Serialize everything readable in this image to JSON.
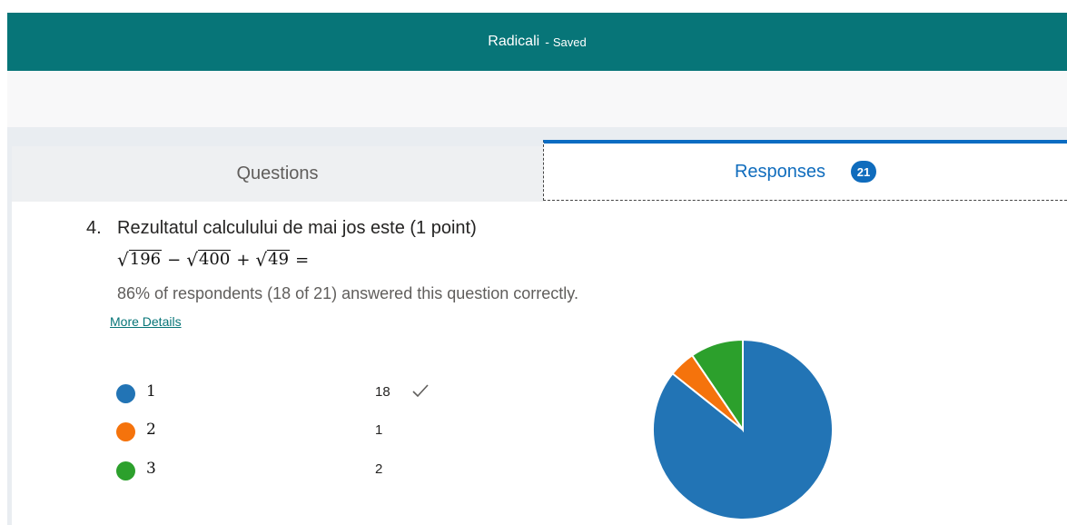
{
  "header": {
    "title": "Radicali",
    "separator": "-",
    "status": "Saved"
  },
  "tabs": {
    "questions_label": "Questions",
    "responses_label": "Responses",
    "responses_count": "21"
  },
  "question": {
    "number": "4.",
    "title": "Rezultatul calculului de mai jos este (1 point)",
    "formula": {
      "terms": [
        "196",
        "400",
        "49"
      ],
      "operators": [
        "−",
        "+",
        "="
      ]
    },
    "summary": "86% of respondents (18 of 21) answered this question correctly.",
    "more_details": "More Details"
  },
  "legend": [
    {
      "label": "1",
      "count": "18",
      "correct": true,
      "color": "#2274b5"
    },
    {
      "label": "2",
      "count": "1",
      "correct": false,
      "color": "#f5730c"
    },
    {
      "label": "3",
      "count": "2",
      "correct": false,
      "color": "#2ca02c"
    }
  ],
  "chart_data": {
    "type": "pie",
    "categories": [
      "1",
      "2",
      "3"
    ],
    "values": [
      18,
      1,
      2
    ],
    "colors": [
      "#2274b5",
      "#f5730c",
      "#2ca02c"
    ]
  },
  "icons": {
    "correct": "checkmark-icon"
  }
}
